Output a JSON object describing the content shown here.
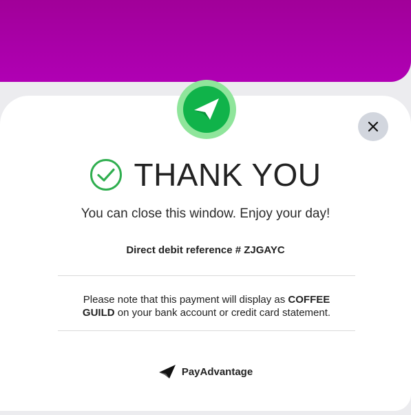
{
  "colors": {
    "banner": "#a8009f",
    "logo_ring": "#8fe59b",
    "logo_fill": "#10b34a",
    "check_green": "#2fae4f",
    "close_bg": "#d2d6de"
  },
  "icons": {
    "logo": "payadvantage-logo-icon",
    "close": "close-icon",
    "success": "check-circle-icon",
    "brand": "payadvantage-mark-icon"
  },
  "thank_you": {
    "heading": "THANK YOU",
    "subtitle": "You can close this window. Enjoy your day!"
  },
  "reference": {
    "text": "Direct debit reference # ZJGAYC"
  },
  "note": {
    "prefix": "Please note that this payment will display as ",
    "merchant": "COFFEE GUILD",
    "suffix": " on your bank account or credit card statement."
  },
  "footer": {
    "brand": "PayAdvantage"
  }
}
